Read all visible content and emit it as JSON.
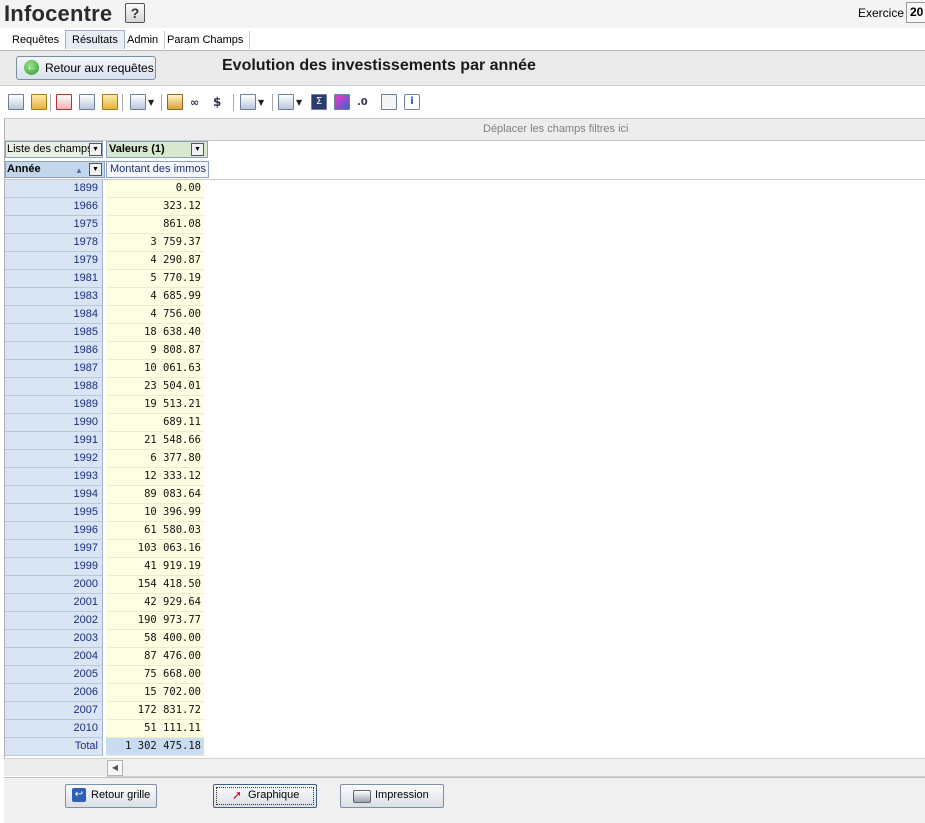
{
  "app": {
    "title": "Infocentre",
    "help_label": "?",
    "exercice_label": "Exercice",
    "exercice_value": "20"
  },
  "tabs": [
    {
      "label": "Requêtes",
      "active": false
    },
    {
      "label": "Résultats",
      "active": true
    },
    {
      "label": "Admin",
      "active": false
    },
    {
      "label": "Param Champs",
      "active": false
    }
  ],
  "result": {
    "back_button_label": "Retour aux requêtes",
    "page_title": "Evolution des investissements par année"
  },
  "toolbar": {
    "icons": [
      "save-icon",
      "open-icon",
      "delete-layout-icon",
      "save-as-icon",
      "open-folder-icon",
      "export-icon",
      "cubes-icon",
      "goggles-icon",
      "currency-icon",
      "layout-icon",
      "filter-layout-icon",
      "sigma-icon",
      "chart-icon",
      "decimal-icon",
      "list-icon",
      "info-icon"
    ]
  },
  "pivot": {
    "filter_area_label": "Déplacer les champs filtres ici",
    "field_list_label": "Liste des champs",
    "values_label": "Valeurs (1)",
    "row_field_label": "Année",
    "measure_label": "Montant des immos",
    "rows": [
      {
        "year": "1899",
        "value": "0.00"
      },
      {
        "year": "1966",
        "value": "323.12"
      },
      {
        "year": "1975",
        "value": "861.08"
      },
      {
        "year": "1978",
        "value": "3 759.37"
      },
      {
        "year": "1979",
        "value": "4 290.87"
      },
      {
        "year": "1981",
        "value": "5 770.19"
      },
      {
        "year": "1983",
        "value": "4 685.99"
      },
      {
        "year": "1984",
        "value": "4 756.00"
      },
      {
        "year": "1985",
        "value": "18 638.40"
      },
      {
        "year": "1986",
        "value": "9 808.87"
      },
      {
        "year": "1987",
        "value": "10 061.63"
      },
      {
        "year": "1988",
        "value": "23 504.01"
      },
      {
        "year": "1989",
        "value": "19 513.21"
      },
      {
        "year": "1990",
        "value": "689.11"
      },
      {
        "year": "1991",
        "value": "21 548.66"
      },
      {
        "year": "1992",
        "value": "6 377.80"
      },
      {
        "year": "1993",
        "value": "12 333.12"
      },
      {
        "year": "1994",
        "value": "89 083.64"
      },
      {
        "year": "1995",
        "value": "10 396.99"
      },
      {
        "year": "1996",
        "value": "61 580.03"
      },
      {
        "year": "1997",
        "value": "103 063.16"
      },
      {
        "year": "1999",
        "value": "41 919.19"
      },
      {
        "year": "2000",
        "value": "154 418.50"
      },
      {
        "year": "2001",
        "value": "42 929.64"
      },
      {
        "year": "2002",
        "value": "190 973.77"
      },
      {
        "year": "2003",
        "value": "58 400.00"
      },
      {
        "year": "2004",
        "value": "87 476.00"
      },
      {
        "year": "2005",
        "value": "75 668.00"
      },
      {
        "year": "2006",
        "value": "15 702.00"
      },
      {
        "year": "2007",
        "value": "172 831.72"
      },
      {
        "year": "2010",
        "value": "51 111.11"
      }
    ],
    "total": {
      "label": "Total",
      "value": "1 302 475.18"
    }
  },
  "bottom": {
    "retour_grille_label": "Retour grille",
    "graphique_label": "Graphique",
    "impression_label": "Impression"
  }
}
